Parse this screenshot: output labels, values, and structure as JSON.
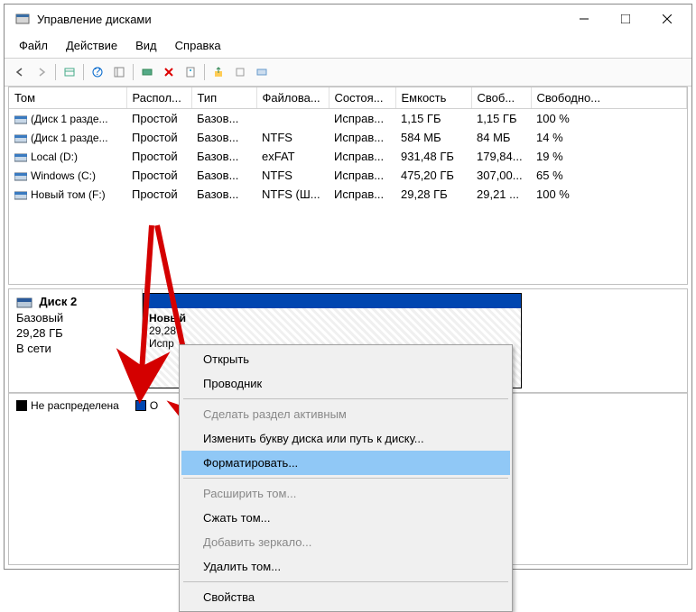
{
  "window": {
    "title": "Управление дисками"
  },
  "menu": {
    "items": [
      "Файл",
      "Действие",
      "Вид",
      "Справка"
    ]
  },
  "table": {
    "headers": [
      "Том",
      "Распол...",
      "Тип",
      "Файлова...",
      "Состоя...",
      "Емкость",
      "Своб...",
      "Свободно..."
    ],
    "rows": [
      {
        "vol": "(Диск 1 разде...",
        "layout": "Простой",
        "type": "Базов...",
        "fs": "",
        "status": "Исправ...",
        "cap": "1,15 ГБ",
        "free": "1,15 ГБ",
        "pct": "100 %"
      },
      {
        "vol": "(Диск 1 разде...",
        "layout": "Простой",
        "type": "Базов...",
        "fs": "NTFS",
        "status": "Исправ...",
        "cap": "584 МБ",
        "free": "84 МБ",
        "pct": "14 %"
      },
      {
        "vol": "Local (D:)",
        "layout": "Простой",
        "type": "Базов...",
        "fs": "exFAT",
        "status": "Исправ...",
        "cap": "931,48 ГБ",
        "free": "179,84...",
        "pct": "19 %"
      },
      {
        "vol": "Windows (C:)",
        "layout": "Простой",
        "type": "Базов...",
        "fs": "NTFS",
        "status": "Исправ...",
        "cap": "475,20 ГБ",
        "free": "307,00...",
        "pct": "65 %"
      },
      {
        "vol": "Новый том (F:)",
        "layout": "Простой",
        "type": "Базов...",
        "fs": "NTFS (Ш...",
        "status": "Исправ...",
        "cap": "29,28 ГБ",
        "free": "29,21 ...",
        "pct": "100 %"
      }
    ]
  },
  "disk": {
    "name": "Диск 2",
    "type": "Базовый",
    "size": "29,28 ГБ",
    "status": "В сети",
    "partition": {
      "name": "Новый",
      "size": "29,28",
      "state": "Испр"
    }
  },
  "legend": {
    "unallocated": "Не распределена",
    "primary_prefix": "О"
  },
  "context": {
    "open": "Открыть",
    "explorer": "Проводник",
    "active": "Сделать раздел активным",
    "letter": "Изменить букву диска или путь к диску...",
    "format": "Форматировать...",
    "extend": "Расширить том...",
    "shrink": "Сжать том...",
    "mirror": "Добавить зеркало...",
    "delete": "Удалить том...",
    "properties": "Свойства"
  },
  "colors": {
    "partition_header": "#0046b0",
    "context_highlight": "#90c8f6",
    "arrow": "#d40000"
  }
}
